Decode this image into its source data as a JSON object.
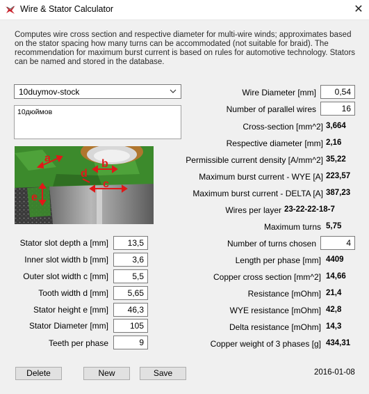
{
  "window": {
    "title": "Wire & Stator Calculator",
    "close_glyph": "✕"
  },
  "description": "Computes wire cross section and respective diameter for multi-wire winds; approximates based on the stator spacing how many turns can be accommodated (not suitable for braid). The recommendation for maximum burst current is based on rules for automotive technology. Stators can be named and stored in the database.",
  "stator_select": {
    "value": "10duymov-stock"
  },
  "notes": "10дюймов",
  "image_labels": {
    "a": "a",
    "b": "b",
    "c": "c",
    "d": "d",
    "e": "e"
  },
  "stator_inputs": [
    {
      "label": "Stator slot depth a [mm]",
      "value": "13,5"
    },
    {
      "label": "Inner slot width b [mm]",
      "value": "3,6"
    },
    {
      "label": "Outer slot width c [mm]",
      "value": "5,5"
    },
    {
      "label": "Tooth width d [mm]",
      "value": "5,65"
    },
    {
      "label": "Stator height e [mm]",
      "value": "46,3"
    },
    {
      "label": "Stator Diameter [mm]",
      "value": "105"
    },
    {
      "label": "Teeth per phase",
      "value": "9"
    }
  ],
  "wire": {
    "diameter_label": "Wire Diameter [mm]",
    "diameter_value": "0,54",
    "parallel_label": "Number of parallel wires",
    "parallel_value": "16"
  },
  "results_top": [
    {
      "label": "Cross-section [mm^2]",
      "value": "3,664"
    },
    {
      "label": "Respective diameter [mm]",
      "value": "2,16"
    },
    {
      "label": "Permissible current density [A/mm^2]",
      "value": "35,22"
    },
    {
      "label": "Maximum burst current - WYE [A]",
      "value": "223,57"
    },
    {
      "label": "Maximum burst current - DELTA [A]",
      "value": "387,23"
    }
  ],
  "wires_per_layer": {
    "label": "Wires per layer",
    "value": "23-22-22-18-7"
  },
  "max_turns": {
    "label": "Maximum turns",
    "value": "5,75"
  },
  "turns_chosen": {
    "label": "Number of turns chosen",
    "value": "4"
  },
  "results_bottom": [
    {
      "label": "Length per phase [mm]",
      "value": "4409"
    },
    {
      "label": "Copper cross section [mm^2]",
      "value": "14,66"
    },
    {
      "label": "Resistance [mOhm]",
      "value": "21,4"
    },
    {
      "label": "WYE resistance [mOhm]",
      "value": "42,8"
    },
    {
      "label": "Delta resistance [mOhm]",
      "value": "14,3"
    },
    {
      "label": "Copper weight of 3 phases [g]",
      "value": "434,31"
    }
  ],
  "buttons": {
    "delete": "Delete",
    "new": "New",
    "save": "Save"
  },
  "date": "2016-01-08",
  "colors": {
    "background": "#f0f0f0",
    "arrow_red": "#e01818",
    "stator_green": "#3c8a2c"
  }
}
